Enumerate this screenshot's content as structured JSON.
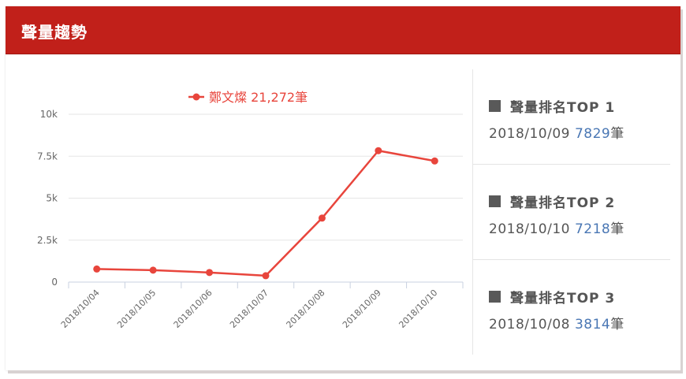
{
  "header": {
    "title": "聲量趨勢"
  },
  "legend": {
    "label": "鄭文燦 21,272筆"
  },
  "colors": {
    "series": "#e8453c",
    "header": "#c1201a",
    "count": "#4a77b4"
  },
  "chart_data": {
    "type": "line",
    "title": "",
    "xlabel": "",
    "ylabel": "",
    "categories": [
      "2018/10/04",
      "2018/10/05",
      "2018/10/06",
      "2018/10/07",
      "2018/10/08",
      "2018/10/09",
      "2018/10/10"
    ],
    "series": [
      {
        "name": "鄭文燦 21,272筆",
        "values": [
          780,
          710,
          570,
          380,
          3814,
          7829,
          7218
        ]
      }
    ],
    "ylim": [
      0,
      10000
    ],
    "yticks": [
      0,
      2500,
      5000,
      7500,
      10000
    ],
    "ytick_labels": [
      "0",
      "2.5k",
      "5k",
      "7.5k",
      "10k"
    ],
    "grid": true,
    "legend_position": "top-center"
  },
  "ranking": [
    {
      "title": "聲量排名TOP 1",
      "date": "2018/10/09",
      "count": "7829",
      "unit": "筆"
    },
    {
      "title": "聲量排名TOP 2",
      "date": "2018/10/10",
      "count": "7218",
      "unit": "筆"
    },
    {
      "title": "聲量排名TOP 3",
      "date": "2018/10/08",
      "count": "3814",
      "unit": "筆"
    }
  ]
}
